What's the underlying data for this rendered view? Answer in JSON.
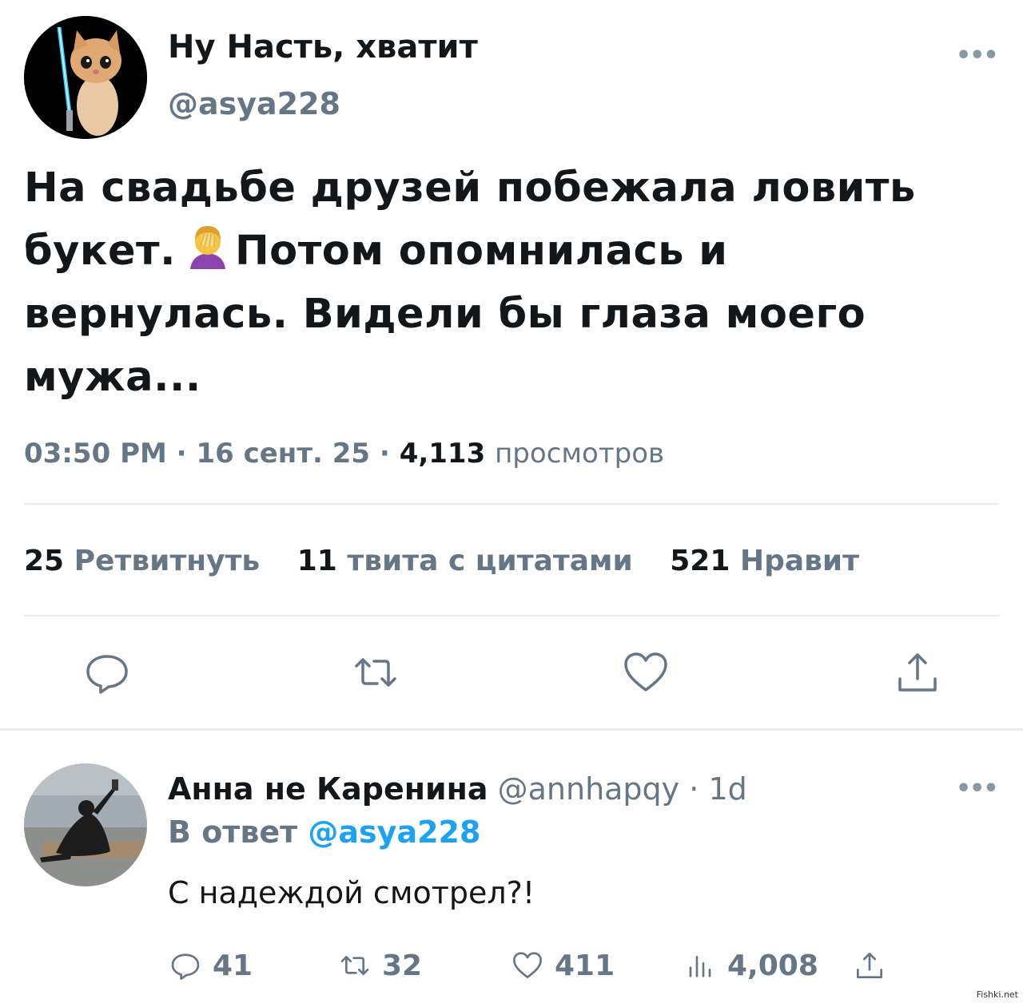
{
  "tweet": {
    "author_name": "Ну Насть, хватит",
    "author_handle": "@asya228",
    "more_label": "•••",
    "text_lines": [
      "На свадьбе друзей побежала ловить",
      "букет.",
      "Потом опомнилась и",
      "вернулась. Видели бы глаза моего",
      "мужа..."
    ],
    "time": "03:50 PM",
    "separator": "·",
    "date": "16 сент. 25",
    "views_count": "4,113",
    "views_label": "просмотров"
  },
  "stats": {
    "retweets_count": "25",
    "retweets_label": "Ретвитнуть",
    "quotes_count": "11",
    "quotes_label": "твита с цитатами",
    "likes_count": "521",
    "likes_label": "Нравит"
  },
  "actions": {
    "reply_icon": "comment-icon",
    "retweet_icon": "retweet-icon",
    "like_icon": "heart-icon",
    "share_icon": "share-icon"
  },
  "reply": {
    "author_name": "Анна не Каренина",
    "author_handle": "@annhapqy",
    "separator": "·",
    "age": "1d",
    "more_label": "•••",
    "in_reply_to_label": "В ответ",
    "in_reply_to_handle": "@asya228",
    "text": "С надеждой смотрел?!",
    "reply_count": "41",
    "retweet_count": "32",
    "like_count": "411",
    "views_count": "4,008"
  },
  "watermark": "Fishki.net",
  "colors": {
    "text_primary": "#14171a",
    "text_secondary": "#657786",
    "link": "#1da1f2",
    "divider": "#e6ecf0"
  }
}
